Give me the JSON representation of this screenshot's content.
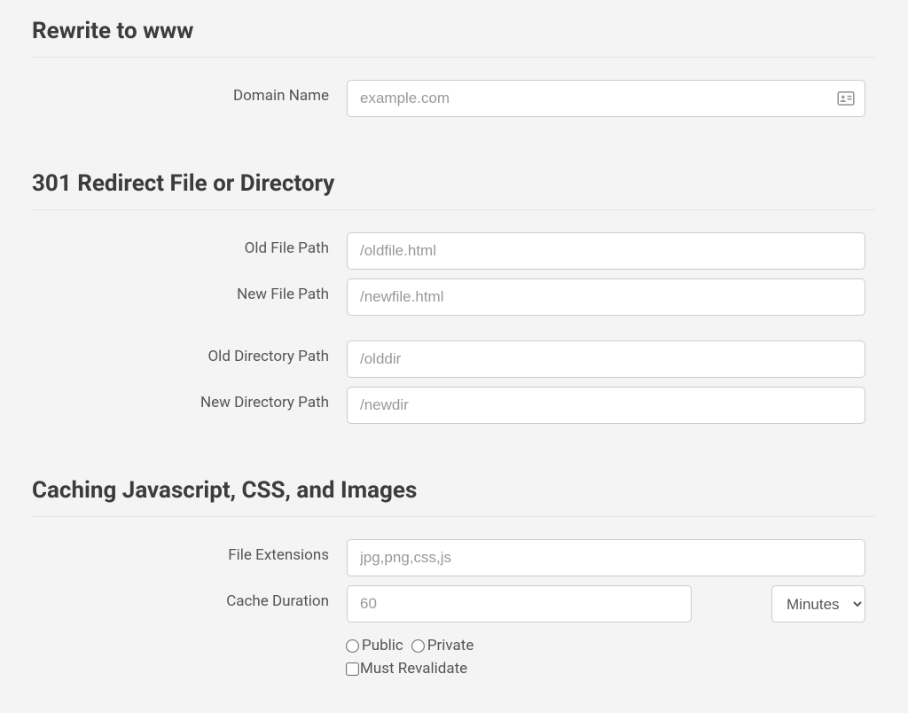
{
  "rewrite": {
    "title": "Rewrite to www",
    "domainName": {
      "label": "Domain Name",
      "placeholder": "example.com"
    }
  },
  "redirect": {
    "title": "301 Redirect File or Directory",
    "oldFilePath": {
      "label": "Old File Path",
      "placeholder": "/oldfile.html"
    },
    "newFilePath": {
      "label": "New File Path",
      "placeholder": "/newfile.html"
    },
    "oldDirPath": {
      "label": "Old Directory Path",
      "placeholder": "/olddir"
    },
    "newDirPath": {
      "label": "New Directory Path",
      "placeholder": "/newdir"
    }
  },
  "caching": {
    "title": "Caching Javascript, CSS, and Images",
    "fileExtensions": {
      "label": "File Extensions",
      "placeholder": "jpg,png,css,js"
    },
    "cacheDuration": {
      "label": "Cache Duration",
      "placeholder": "60",
      "unit": "Minutes"
    },
    "visibility": {
      "public": "Public",
      "private": "Private"
    },
    "mustRevalidate": "Must Revalidate"
  }
}
